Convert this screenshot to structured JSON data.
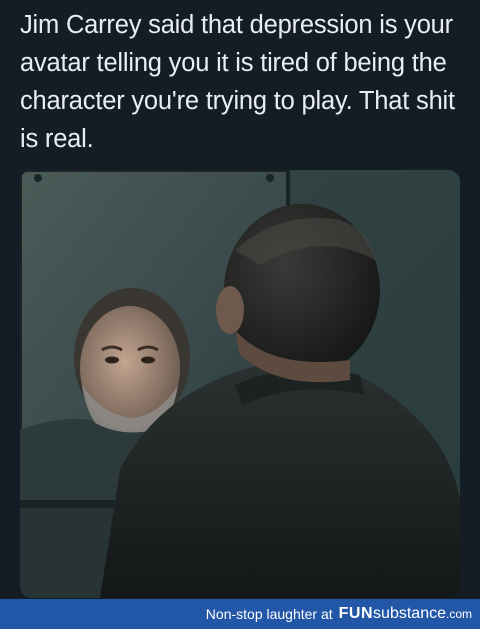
{
  "post": {
    "text": "Jim Carrey said that depression is your avatar telling you it is tired of being the character you're trying to play. That shit is real."
  },
  "image": {
    "description_icon": "photo-man-looking-in-mirror"
  },
  "footer": {
    "tagline": "Non-stop laughter at",
    "brand_bold": "FUN",
    "brand_regular": "substance",
    "brand_domain": ".com"
  },
  "colors": {
    "background": "#141d26",
    "text": "#e9eef2",
    "footer_bar": "#2157a6"
  }
}
